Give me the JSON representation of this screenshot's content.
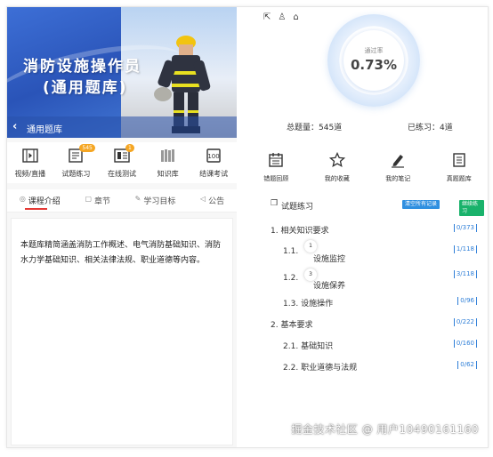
{
  "banner": {
    "title_line1": "消防设施操作员",
    "title_line2": "(通用题库)",
    "back_label": "通用题库"
  },
  "quick_icons": [
    {
      "label": "视频/直播",
      "icon": "video-icon",
      "badge": ""
    },
    {
      "label": "试题练习",
      "icon": "practice-icon",
      "badge": "545"
    },
    {
      "label": "在线测试",
      "icon": "test-icon",
      "badge": "1"
    },
    {
      "label": "知识库",
      "icon": "library-icon",
      "badge": ""
    },
    {
      "label": "结课考试",
      "icon": "exam-icon",
      "badge": ""
    }
  ],
  "tabs": [
    {
      "label": "课程介绍",
      "icon": "info-icon"
    },
    {
      "label": "章节",
      "icon": "chapter-icon"
    },
    {
      "label": "学习目标",
      "icon": "target-icon"
    },
    {
      "label": "公告",
      "icon": "notice-icon"
    }
  ],
  "description": "本题库精简涵盖消防工作概述、电气消防基础知识、消防水力学基础知识、相关法律法规、职业道德等内容。",
  "gauge": {
    "label": "通过率",
    "value": "0.73%",
    "ring_color": "#d6e6fa"
  },
  "stats": {
    "total": "总题量：545道",
    "practiced": "已练习：4道"
  },
  "actions": [
    {
      "label": "错题回顾",
      "icon": "calendar-icon"
    },
    {
      "label": "我的收藏",
      "icon": "star-icon"
    },
    {
      "label": "我的笔记",
      "icon": "pen-icon"
    },
    {
      "label": "真题题库",
      "icon": "book-icon"
    }
  ],
  "practice": {
    "title": "试题练习",
    "btn_clear": "清空所有记录",
    "btn_continue": "继续练习",
    "btn_clear_color": "#2f8fe0",
    "btn_continue_color": "#19b26b"
  },
  "tree": [
    {
      "num": "1.",
      "label": "相关知识要求",
      "count": "0/373",
      "level": 1,
      "badge": ""
    },
    {
      "num": "1.1.",
      "label": "设施监控",
      "count": "1/118",
      "level": 2,
      "badge": "1"
    },
    {
      "num": "1.2.",
      "label": "设施保养",
      "count": "3/118",
      "level": 2,
      "badge": "3"
    },
    {
      "num": "1.3.",
      "label": "设施操作",
      "count": "0/96",
      "level": 2,
      "badge": ""
    },
    {
      "num": "2.",
      "label": "基本要求",
      "count": "0/222",
      "level": 1,
      "badge": ""
    },
    {
      "num": "2.1.",
      "label": "基础知识",
      "count": "0/160",
      "level": 2,
      "badge": ""
    },
    {
      "num": "2.2.",
      "label": "职业道德与法规",
      "count": "0/62",
      "level": 2,
      "badge": ""
    }
  ],
  "watermark": "掘金技术社区 @ 用户10490161160",
  "topbar_icons": [
    "share-icon",
    "user-icon",
    "home-icon"
  ]
}
